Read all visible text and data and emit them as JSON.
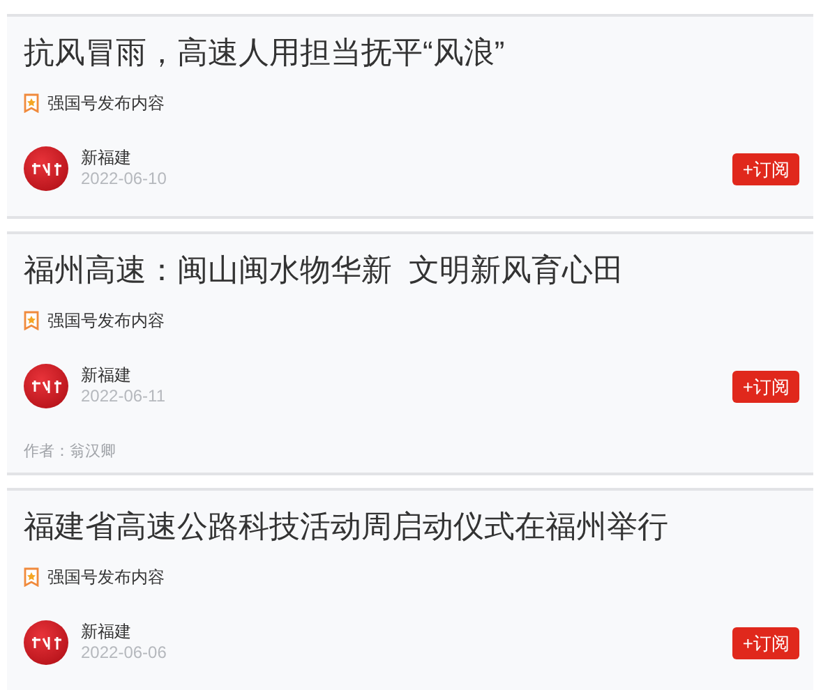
{
  "articles": [
    {
      "title": "抗风冒雨，高速人用担当抚平“风浪”",
      "source_badge": "强国号发布内容",
      "channel": "新福建",
      "date": "2022-06-10",
      "subscribe_button": "+订阅"
    },
    {
      "title": "福州高速：闽山闽水物华新  文明新风育心田",
      "source_badge": "强国号发布内容",
      "channel": "新福建",
      "date": "2022-06-11",
      "subscribe_button": "+订阅",
      "byline": "作者：翁汉卿"
    },
    {
      "title": "福建省高速公路科技活动周启动仪式在福州举行",
      "source_badge": "强国号发布内容",
      "channel": "新福建",
      "date": "2022-06-06",
      "subscribe_button": "+订阅"
    }
  ]
}
